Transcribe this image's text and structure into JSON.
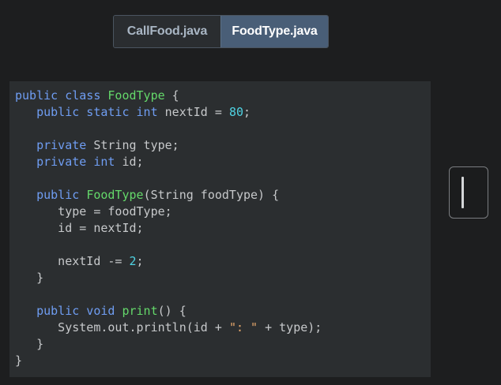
{
  "tabs": [
    {
      "label": "CallFood.java",
      "active": false
    },
    {
      "label": "FoodType.java",
      "active": true
    }
  ],
  "code": {
    "lines": [
      [
        {
          "t": "public class ",
          "c": "kw"
        },
        {
          "t": "FoodType",
          "c": "fn"
        },
        {
          "t": " {",
          "c": ""
        }
      ],
      [
        {
          "t": "   public static int ",
          "c": "kw"
        },
        {
          "t": "nextId = ",
          "c": ""
        },
        {
          "t": "80",
          "c": "num"
        },
        {
          "t": ";",
          "c": ""
        }
      ],
      [],
      [
        {
          "t": "   private ",
          "c": "kw"
        },
        {
          "t": "String type;",
          "c": ""
        }
      ],
      [
        {
          "t": "   private int ",
          "c": "kw"
        },
        {
          "t": "id;",
          "c": ""
        }
      ],
      [],
      [
        {
          "t": "   public ",
          "c": "kw"
        },
        {
          "t": "FoodType",
          "c": "fn"
        },
        {
          "t": "(String foodType) {",
          "c": ""
        }
      ],
      [
        {
          "t": "      type = foodType;",
          "c": ""
        }
      ],
      [
        {
          "t": "      id = nextId;",
          "c": ""
        }
      ],
      [],
      [
        {
          "t": "      nextId -= ",
          "c": ""
        },
        {
          "t": "2",
          "c": "num"
        },
        {
          "t": ";",
          "c": ""
        }
      ],
      [
        {
          "t": "   }",
          "c": ""
        }
      ],
      [],
      [
        {
          "t": "   public void ",
          "c": "kw"
        },
        {
          "t": "print",
          "c": "fn"
        },
        {
          "t": "() {",
          "c": ""
        }
      ],
      [
        {
          "t": "      System.out.println(id + ",
          "c": ""
        },
        {
          "t": "\": \"",
          "c": "str"
        },
        {
          "t": " + type);",
          "c": ""
        }
      ],
      [
        {
          "t": "   }",
          "c": ""
        }
      ],
      [
        {
          "t": "}",
          "c": ""
        }
      ]
    ]
  },
  "colors": {
    "keyword": "#6f9df2",
    "function": "#64d86a",
    "number": "#4fd3e3",
    "string": "#e6a86d",
    "active_tab": "#495e77"
  },
  "icons": {
    "scroll_handle": "vertical-bar-icon"
  }
}
